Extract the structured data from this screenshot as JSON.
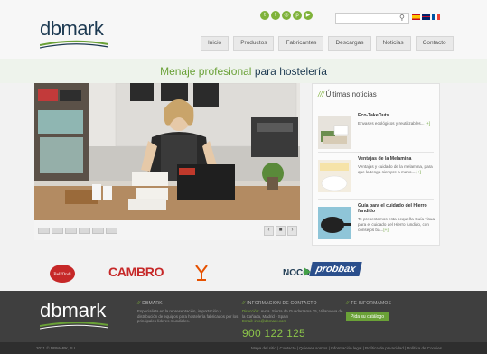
{
  "header": {
    "logo_text": "dbmark",
    "search_placeholder": "",
    "nav": [
      "Inicio",
      "Productos",
      "Fabricantes",
      "Descargas",
      "Noticias",
      "Contacto"
    ],
    "social_icons": [
      "twitter-icon",
      "facebook-icon",
      "instagram-icon",
      "pinterest-icon",
      "youtube-icon"
    ],
    "flags": [
      "flag-es-icon",
      "flag-uk-icon",
      "flag-fr-icon"
    ]
  },
  "tagline": {
    "part1": "Menaje profesional",
    "part2": "para",
    "part3": "hostelería"
  },
  "news": {
    "title": "Últimas noticias",
    "title_prefix": "///",
    "items": [
      {
        "title": "Eco-TakeOuts",
        "text": "Envases ecológicos y reutilizables...",
        "more": "[+]"
      },
      {
        "title": "Ventajas de la Melamina",
        "text": "Ventajas y cuidado de la melamina, para que la tenga siempre a mano....",
        "more": "[+]"
      },
      {
        "title": "Guía para el cuidado del Hierro fundido",
        "text": "Te presentamos esta pequeña Guía visual para el cuidado del Hierro fundido, con consejos bá...",
        "more": "[+]"
      }
    ]
  },
  "slider": {
    "prev": "‹",
    "pause": "■",
    "next": "›",
    "dot_count": 6
  },
  "brands": [
    "Bell'Ondì",
    "CAMBRO",
    "NOCO",
    "probbax"
  ],
  "footer": {
    "logo_text": "dbmark",
    "col1": {
      "prefix": "//",
      "title": "DBMARK",
      "text": "Especialista en la representación, importación y distribución de equipos para hostelería fabricados por los principales líderes mundiales."
    },
    "col2": {
      "prefix": "//",
      "title": "INFORMACION DE CONTACTO",
      "addr_label": "Dirección:",
      "addr": "Avda. Sierra de Guadarrama 25, Villanueva de la Cañada, Madrid - Spain",
      "email_label": "Email:",
      "email": "info@dbmark.com",
      "phone": "900 122 125"
    },
    "col3": {
      "prefix": "//",
      "title": "TE INFORMAMOS",
      "button": "Pida su catálogo"
    },
    "copyright": "2021 © DBMARK, S.L.",
    "legal": "Mapa del sitio | Contacto | Quienes somos | Información legal | Política de privacidad | Política de Cookies"
  },
  "colors": {
    "brand_green": "#6aa137",
    "brand_navy": "#1d3a52",
    "footer_bg": "#3f3f3f"
  }
}
